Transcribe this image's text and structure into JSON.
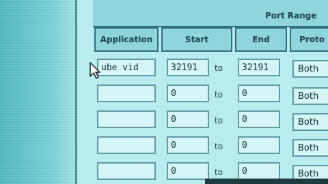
{
  "header": {
    "port_range_label": "Port Range"
  },
  "columns": {
    "application": "Application",
    "start": "Start",
    "end": "End",
    "protocol": "Proto"
  },
  "rows": [
    {
      "application": "ube vid",
      "start": "32191",
      "to": "to",
      "end": "32191",
      "protocol": "Both"
    },
    {
      "application": "",
      "start": "0",
      "to": "to",
      "end": "0",
      "protocol": "Both"
    },
    {
      "application": "",
      "start": "0",
      "to": "to",
      "end": "0",
      "protocol": "Both"
    },
    {
      "application": "",
      "start": "0",
      "to": "to",
      "end": "0",
      "protocol": "Both"
    },
    {
      "application": "",
      "start": "0",
      "to": "to",
      "end": "0",
      "protocol": "Both"
    }
  ],
  "icons": {
    "cursor": "mouse-pointer-icon"
  }
}
